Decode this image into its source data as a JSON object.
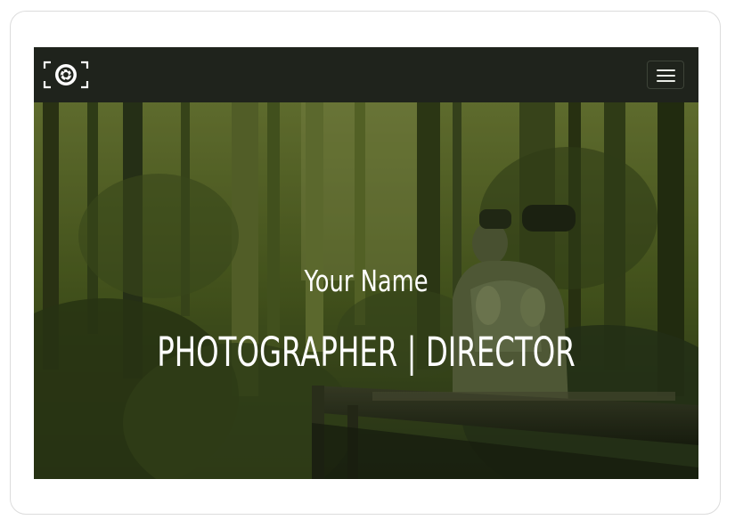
{
  "navbar": {
    "logo_icon": "camera-aperture-icon",
    "menu_icon": "hamburger-menu-icon"
  },
  "hero": {
    "name": "Your Name",
    "role": "PHOTOGRAPHER | DIRECTOR",
    "background_description_colors": {
      "tint": "#3b4a1c",
      "text": "#ffffff"
    }
  },
  "colors": {
    "navbar_bg": "#1f231c",
    "menu_border": "#3d4338",
    "menu_bars": "#e9ece6",
    "hero_tint": "#4d5c24"
  }
}
